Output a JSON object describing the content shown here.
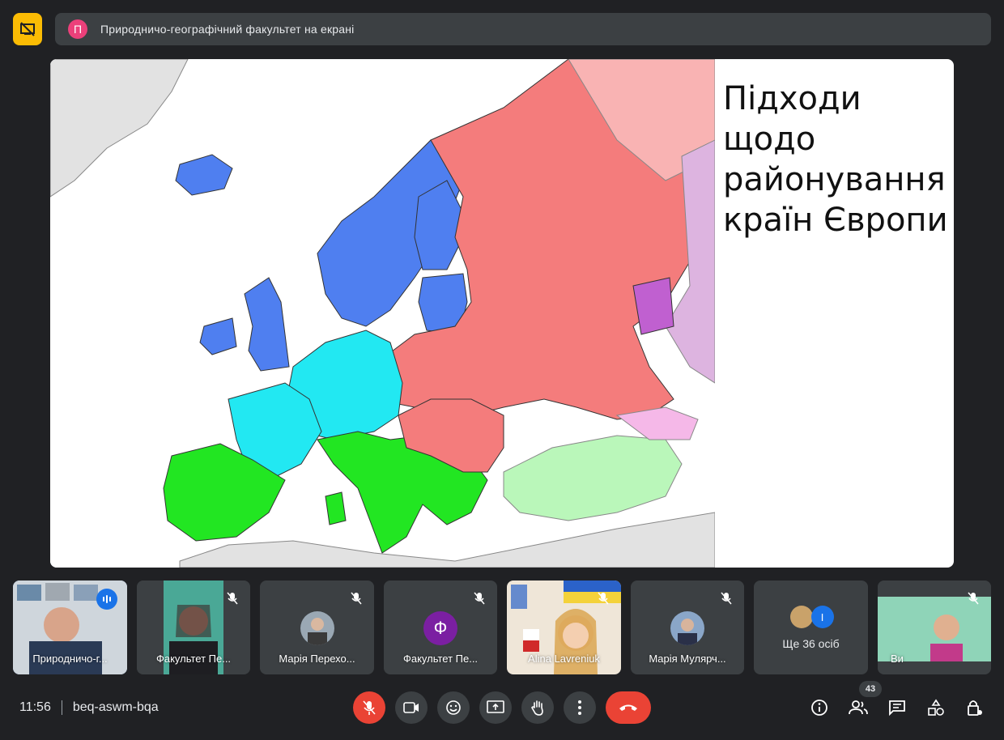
{
  "presentation": {
    "presenter_initial": "П",
    "banner_text": "Природничо-географічний факультет на екрані"
  },
  "slide": {
    "title_lines": [
      "Підходи щодо",
      "районування",
      "країн Європи"
    ]
  },
  "participants": [
    {
      "name": "Природничо-г...",
      "state": "speaking"
    },
    {
      "name": "Факультет Пе...",
      "state": "muted"
    },
    {
      "name": "Марія Перехо...",
      "state": "muted"
    },
    {
      "name": "Факультет Пе...",
      "state": "muted",
      "initial": "Ф"
    },
    {
      "name": "Alina Lavreniuk",
      "state": "muted"
    },
    {
      "name": "Марія Мулярч...",
      "state": "muted"
    },
    {
      "name": "",
      "more": "Ще 36 осіб",
      "mini_initial": "I"
    },
    {
      "name": "Ви",
      "state": "muted"
    }
  ],
  "meeting": {
    "time": "11:56",
    "code": "beq-aswm-bqa",
    "participant_count": "43"
  },
  "colors": {
    "accent_yellow": "#fbbc04",
    "hangup_red": "#ea4335",
    "active_border": "#8ab4f8",
    "background": "#202124"
  }
}
